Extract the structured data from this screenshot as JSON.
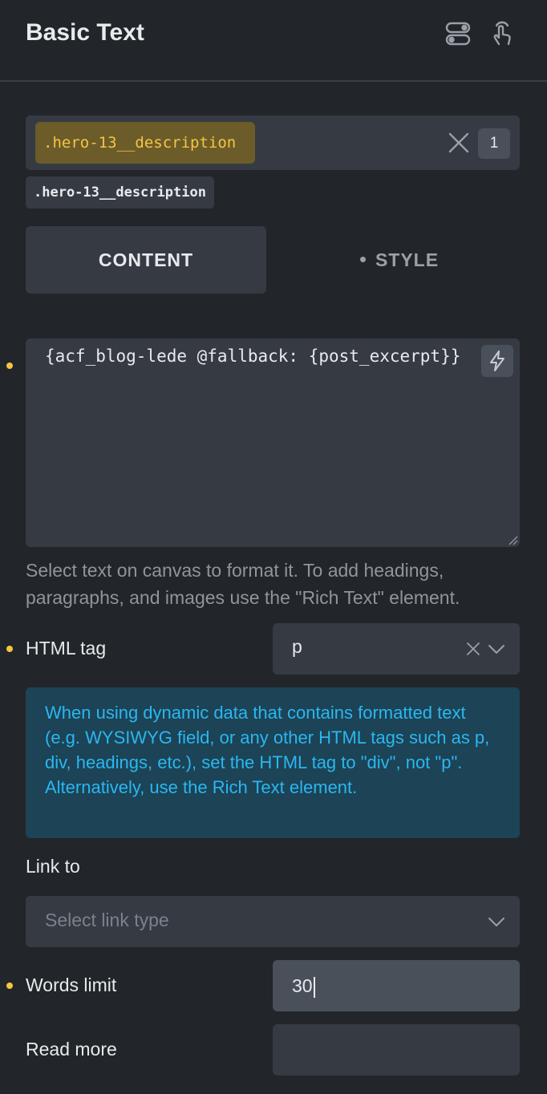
{
  "panel": {
    "title": "Basic Text"
  },
  "selector": {
    "active_class": ".hero-13__description",
    "count": "1",
    "class_tag": ".hero-13__description"
  },
  "tabs": [
    {
      "label": "CONTENT",
      "active": true
    },
    {
      "label": "STYLE",
      "active": false
    }
  ],
  "text": {
    "value": "{acf_blog-lede @fallback: {post_excerpt}}",
    "help": "Select text on canvas to format it. To add headings, paragraphs, and images use the \"Rich Text\" element."
  },
  "html_tag": {
    "label": "HTML tag",
    "value": "p"
  },
  "notice": "When using dynamic data that contains formatted text (e.g. WYSIWYG field, or any other HTML tags such as p, div, headings, etc.), set the HTML tag to \"div\", not \"p\". Alternatively, use the Rich Text element.",
  "link_to": {
    "label": "Link to",
    "placeholder": "Select link type"
  },
  "words_limit": {
    "label": "Words limit",
    "value": "30"
  },
  "read_more": {
    "label": "Read more",
    "value": ""
  },
  "colors": {
    "modified_dot": "#f5c542",
    "selector_chip_bg": "#6b5c2a",
    "selector_chip_text": "#f5c542",
    "notice_bg": "#1c4356",
    "notice_text": "#2ab7f0"
  },
  "icons": [
    "toggle-icon",
    "pointer-hand-icon",
    "close-icon",
    "lightning-icon",
    "resize-grip-icon",
    "chevron-down-icon"
  ]
}
